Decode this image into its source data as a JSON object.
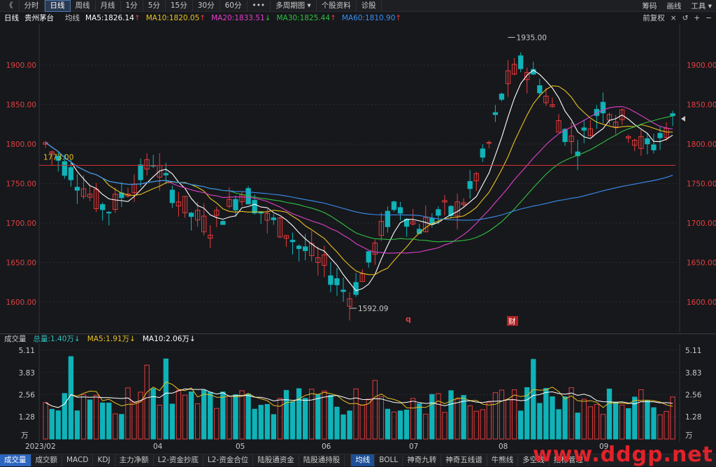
{
  "toolbar": {
    "back": "《",
    "buttons": [
      "分时",
      "日线",
      "周线",
      "月线",
      "1分",
      "5分",
      "15分",
      "30分",
      "60分",
      "•••",
      "多周期图 ▾",
      "个股资料",
      "诊股"
    ],
    "active": "日线",
    "right": [
      "筹码",
      "画线",
      "工具 ▾"
    ]
  },
  "info": {
    "period": "日线",
    "stock": "贵州茅台",
    "ma_label": "均线",
    "ma5": "MA5:1826.14",
    "ma10": "MA10:1820.05",
    "ma20": "MA20:1833.51",
    "ma30": "MA30:1825.44",
    "ma60": "MA60:1810.90",
    "right_label": "前复权",
    "right_icons": [
      "×",
      "↺",
      "+",
      "−"
    ]
  },
  "colors": {
    "up": "#e63b3b",
    "down": "#0fb3b8",
    "ma5": "#ffffff",
    "ma10": "#e8c020",
    "ma20": "#e040c8",
    "ma30": "#30c040",
    "ma60": "#3a8ef0",
    "hline": "#d03030"
  },
  "annotations": {
    "high": "1935.00",
    "low": "1592.09",
    "ref": "1773.00",
    "mark_q": "q",
    "mark_cai": "财"
  },
  "volume": {
    "label": "成交量",
    "total": "总量:1.40万↓",
    "ma5": "MA5:1.91万↓",
    "ma10": "MA10:2.06万↓",
    "unit": "万"
  },
  "dates": [
    "2023/02",
    "04",
    "05",
    "06",
    "07",
    "08",
    "09"
  ],
  "bottom_tabs": [
    "成交量",
    "成交额",
    "MACD",
    "KDJ",
    "主力净额",
    "L2-资金抄底",
    "L2-资金合位",
    "陆股通资金",
    "陆股通持股"
  ],
  "bottom_tabs2": [
    "均线",
    "BOLL",
    "神奇九转",
    "神奇五线谱",
    "牛熊线",
    "多空线",
    "指标管理"
  ],
  "watermark": "www.ddgp.net",
  "chart_data": {
    "type": "candlestick",
    "price_axis": [
      1900,
      1850,
      1800,
      1750,
      1700,
      1650,
      1600
    ],
    "volume_axis": [
      "5.11",
      "3.83",
      "2.56",
      "1.28"
    ],
    "ylim": [
      1580,
      1950
    ],
    "vol_ylim": [
      0,
      5.11
    ],
    "close_path": [
      1800,
      1790,
      1782,
      1773,
      1765,
      1755,
      1745,
      1735,
      1728,
      1722,
      1718,
      1725,
      1735,
      1745,
      1752,
      1760,
      1770,
      1780,
      1765,
      1750,
      1740,
      1730,
      1720,
      1710,
      1705,
      1700,
      1695,
      1705,
      1712,
      1720,
      1730,
      1740,
      1735,
      1725,
      1715,
      1705,
      1700,
      1695,
      1690,
      1680,
      1670,
      1665,
      1660,
      1650,
      1645,
      1635,
      1625,
      1615,
      1608,
      1620,
      1635,
      1650,
      1670,
      1690,
      1705,
      1715,
      1720,
      1710,
      1700,
      1695,
      1700,
      1705,
      1710,
      1715,
      1712,
      1720,
      1730,
      1740,
      1760,
      1780,
      1800,
      1830,
      1860,
      1880,
      1890,
      1900,
      1895,
      1885,
      1875,
      1860,
      1845,
      1830,
      1815,
      1805,
      1800,
      1810,
      1825,
      1840,
      1850,
      1845,
      1835,
      1830,
      1820,
      1810,
      1800,
      1795,
      1800,
      1810,
      1820,
      1830
    ],
    "volume_mean": 2.1
  }
}
